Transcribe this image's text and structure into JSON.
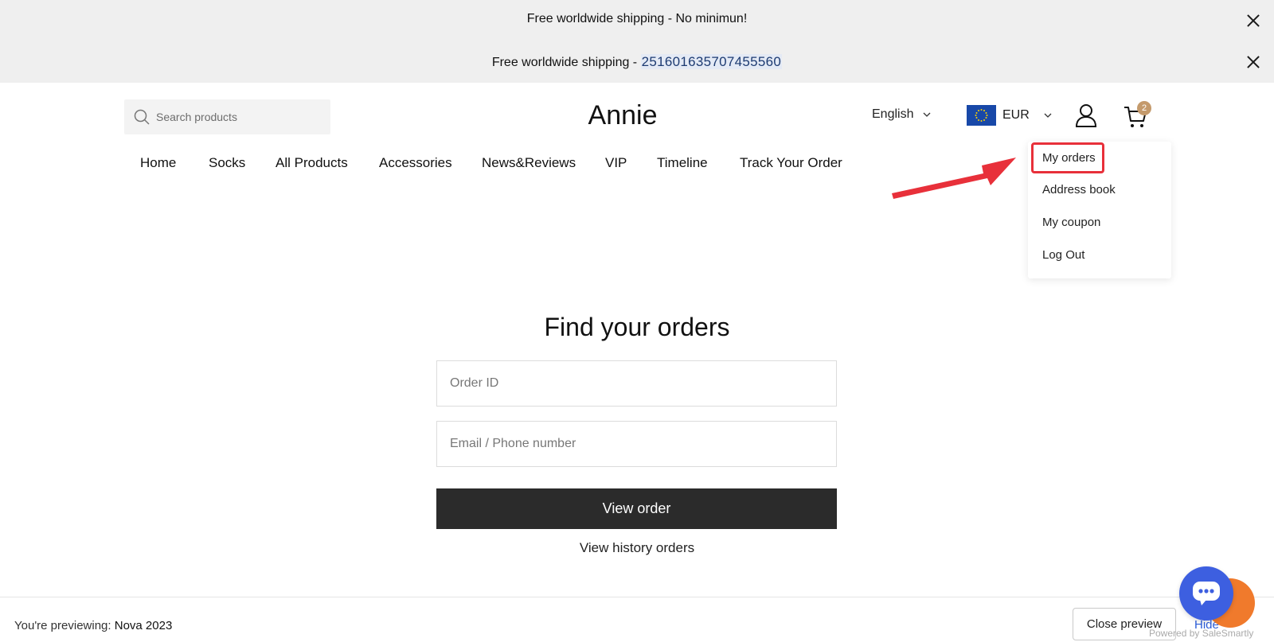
{
  "announcements": [
    {
      "text": "Free worldwide shipping - No minimun!",
      "code": ""
    },
    {
      "text": "Free worldwide shipping - ",
      "code": "251601635707455560"
    }
  ],
  "header": {
    "search_placeholder": "Search products",
    "logo": "Annie",
    "language": "English",
    "currency": "EUR",
    "cart_count": "2"
  },
  "nav": {
    "items": [
      "Home",
      "Socks",
      "All Products",
      "Accessories",
      "News&Reviews",
      "VIP",
      "Timeline",
      "Track Your Order"
    ]
  },
  "account_menu": {
    "items": [
      "My orders",
      "Address book",
      "My coupon",
      "Log Out"
    ],
    "highlighted": "My orders"
  },
  "find_orders": {
    "title": "Find your orders",
    "order_id_placeholder": "Order ID",
    "contact_placeholder": "Email / Phone number",
    "submit_label": "View order",
    "history_label": "View history orders"
  },
  "preview_bar": {
    "prefix": "You're previewing: ",
    "theme_name": "Nova 2023",
    "close_label": "Close preview",
    "hide_label": "Hide"
  },
  "chat": {
    "powered_by": "Powered by SaleSmartly"
  },
  "colors": {
    "announcement_bg": "#efefef",
    "button_bg": "#2b2b2b",
    "highlight": "#e8303a",
    "badge": "#c49a6c",
    "chat_blue": "#3d5fe0",
    "chat_orange": "#f07a2c"
  }
}
